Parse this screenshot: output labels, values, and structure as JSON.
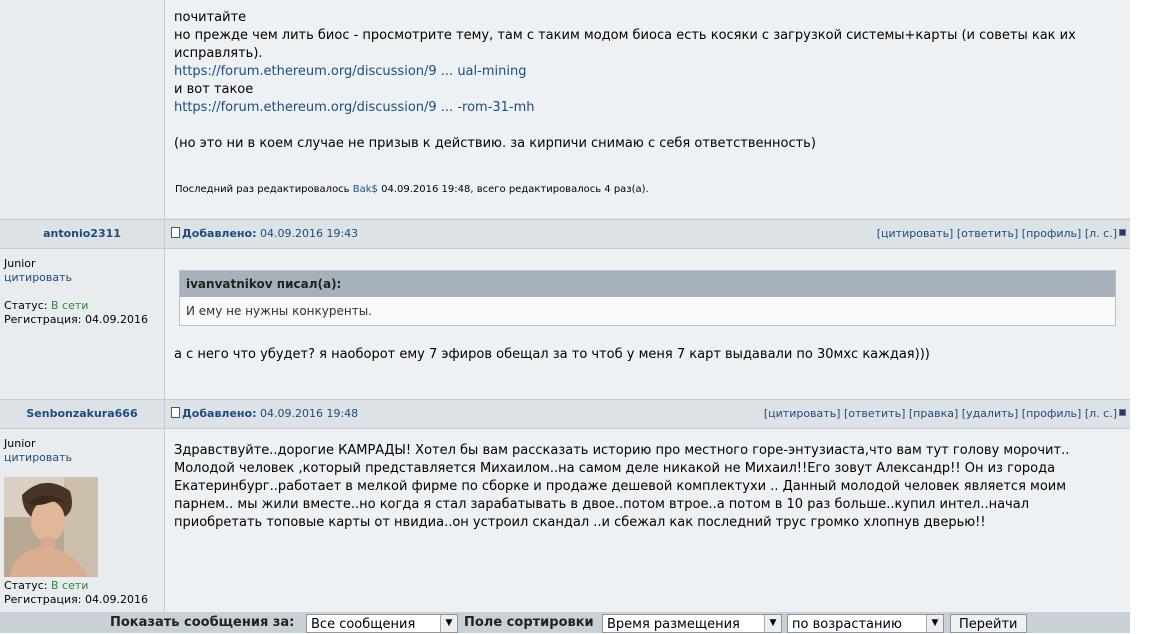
{
  "post1": {
    "lines": [
      "почитайте",
      "но прежде чем лить биос - просмотрите тему, там с таким модом биоса есть косяки с загрузкой системы+карты (и советы как их",
      "исправлять)."
    ],
    "link1": "https://forum.ethereum.org/discussion/9 ... ual-mining",
    "line_between": "и вот такое",
    "link2": "https://forum.ethereum.org/discussion/9 ... -rom-31-mh",
    "disclaimer": "(но это ни в коем случае не призыв к действию. за кирпичи снимаю с себя ответственность)",
    "edit_prefix": "Последний раз редактировалось",
    "edit_user": "Bak$",
    "edit_suffix": "04.09.2016 19:48, всего редактировалось 4 раз(а)."
  },
  "post2": {
    "username": "antonio2311",
    "posted_label": "Добавлено:",
    "posted_date": "04.09.2016 19:43",
    "actions": [
      "[цитировать]",
      "[ответить]",
      "[профиль]",
      "[л. с.]"
    ],
    "rank": "Junior",
    "quote_link": "цитировать",
    "status_label": "Статус:",
    "status_value": "В сети",
    "reg_label": "Регистрация:",
    "reg_value": "04.09.2016",
    "quote_author": "ivanvatnikov писал(а):",
    "quote_text": "И ему не нужны конкуренты.",
    "body": "а с него что убудет? я наоборот ему 7 эфиров обещал за то чтоб у меня 7 карт выдавали по 30мхс каждая)))"
  },
  "post3": {
    "username": "Senbonzakura666",
    "posted_label": "Добавлено:",
    "posted_date": "04.09.2016 19:48",
    "actions": [
      "[цитировать]",
      "[ответить]",
      "[правка]",
      "[удалить]",
      "[профиль]",
      "[л. с.]"
    ],
    "rank": "Junior",
    "quote_link": "цитировать",
    "status_label": "Статус:",
    "status_value": "В сети",
    "reg_label": "Регистрация:",
    "reg_value": "04.09.2016",
    "body_lines": [
      "Здравствуйте..дорогие КАМРАДЫ! Хотел бы вам рассказать историю про местного горе-энтузиаста,что вам тут голову морочит..",
      "Молодой человек ,который представляется Михаилом..на самом деле никакой не Михаил!!Его зовут Александр!! Он из города",
      "Екатеринбург..работает в мелкой фирме по сборке и продаже дешевой комплектухи .. Данный молодой человек является моим",
      "парнем.. мы жили вместе..но когда я стал зарабатывать в двое..потом втрое..а потом в 10 раз больше..купил интел..начал",
      "приобретать топовые карты от нвидиа..он устроил скандал ..и сбежал как последний трус громко хлопнув дверью!!"
    ]
  },
  "bottom": {
    "show_label": "Показать сообщения за:",
    "show_value": "Все сообщения",
    "sort_label": "Поле сортировки",
    "sort_value": "Время размещения",
    "order_value": "по возрастанию",
    "go_button": "Перейти"
  }
}
